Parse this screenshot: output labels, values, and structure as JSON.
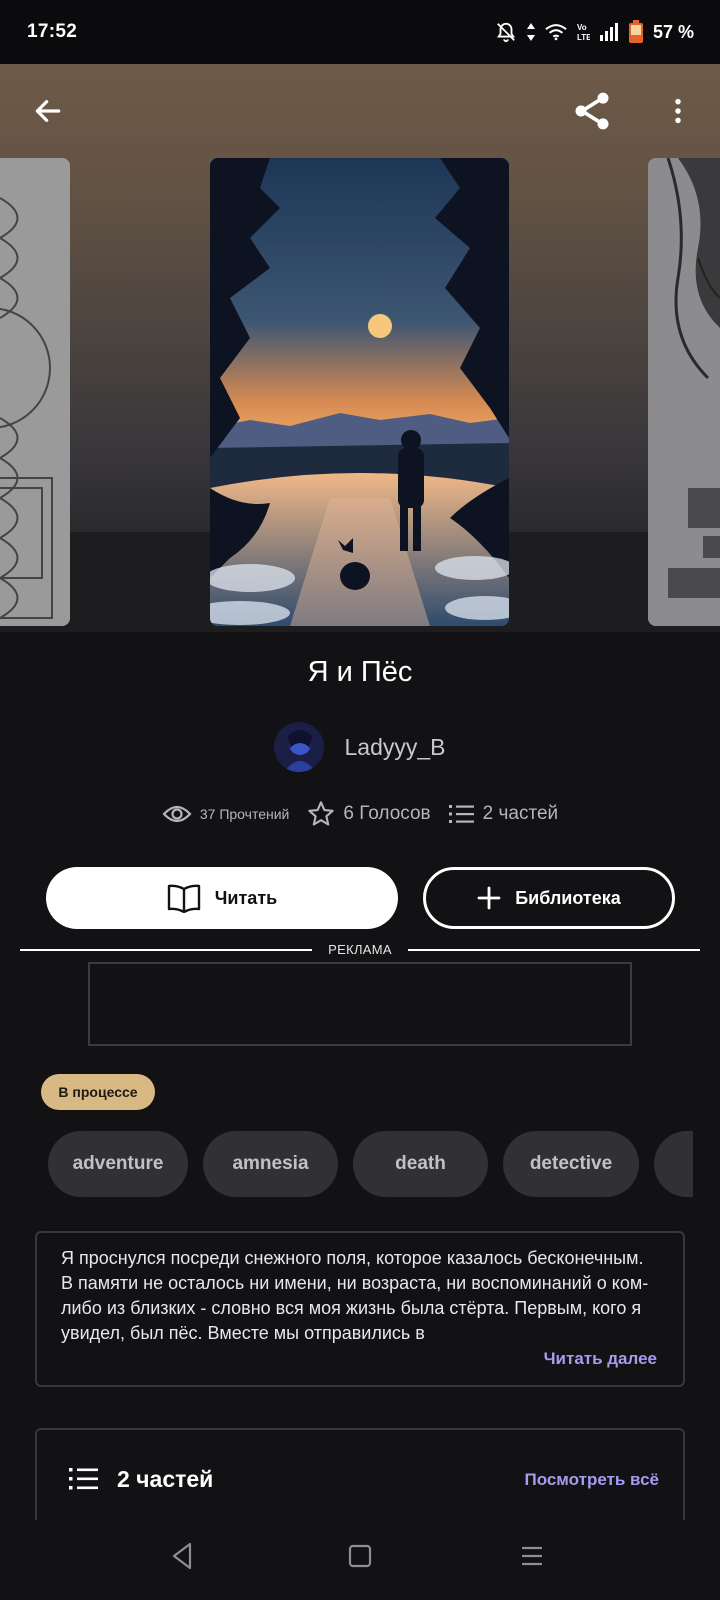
{
  "status_bar": {
    "time": "17:52",
    "battery": "57 %",
    "icons": [
      "bell-off-icon",
      "data-arrows-icon",
      "wifi-icon",
      "volte-icon",
      "signal-icon",
      "battery-icon"
    ]
  },
  "top_bar": {
    "icons": [
      "back-arrow-icon",
      "share-icon",
      "more-vertical-icon"
    ]
  },
  "book": {
    "title": "Я и Пёс",
    "author": "Ladyyy_B",
    "reads": "37 Прочтений",
    "votes": "6 Голосов",
    "parts": "2 частей",
    "status": "В процессе"
  },
  "actions": {
    "read_label": "Читать",
    "library_label": "Библиотека"
  },
  "ad": {
    "label": "РЕКЛАМА"
  },
  "tags": [
    "adventure",
    "amnesia",
    "death",
    "detective"
  ],
  "description": {
    "text": "Я проснулся посреди снежного поля, которое казалось бесконечным. В памяти не осталось ни имени, ни возраста, ни воспоминаний о ком-либо из близких - словно вся моя жизнь была стёрта. Первым, кого я увидел, был пёс. Вместе мы отправились в",
    "read_more": "Читать далее"
  },
  "parts_section": {
    "title": "2 частей",
    "see_all": "Посмотреть всё"
  },
  "colors": {
    "background": "#121114",
    "accent": "#a49cf0",
    "status_badge": "#d8b883"
  }
}
